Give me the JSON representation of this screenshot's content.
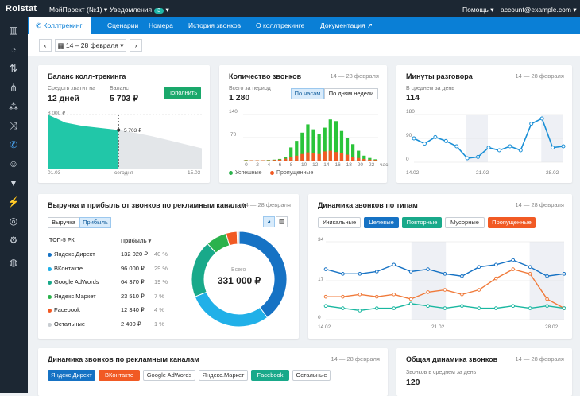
{
  "topbar": {
    "logo": "Roistat",
    "project": "МойПроект (№1)",
    "notifications": "Уведомления",
    "notifications_count": "3",
    "help": "Помощь",
    "account": "account@example.com"
  },
  "subnav": {
    "items": [
      "Коллтрекинг",
      "Сценарии",
      "Номера",
      "История звонков",
      "О коллтрекинге",
      "Документация"
    ]
  },
  "datebar": {
    "range": "14 – 28 февраля"
  },
  "balance": {
    "title": "Баланс колл-трекинга",
    "enough_label": "Средств хватит на",
    "enough_value": "12 дней",
    "balance_label": "Баланс",
    "balance_value": "5 703 ₽",
    "topup": "Пополнить",
    "chart_ylabel": "8 000 ₽",
    "marker": "5 703 ₽",
    "x_start": "01.03",
    "x_mid": "сегодня",
    "x_end": "15.03"
  },
  "calls_count": {
    "title": "Количество звонков",
    "date": "14 — 28 февраля",
    "total_label": "Всего за период",
    "total_value": "1 280",
    "tab_hours": "По часам",
    "tab_days": "По дням недели",
    "y_ticks": [
      "140",
      "70"
    ],
    "x_ticks": [
      "0",
      "2",
      "4",
      "6",
      "8",
      "10",
      "12",
      "14",
      "16",
      "18",
      "20",
      "22",
      "час."
    ],
    "legend_success": "Успешные",
    "legend_missed": "Пропущенные"
  },
  "minutes": {
    "title": "Минуты разговора",
    "date": "14 — 28 февраля",
    "avg_label": "В среднем за день",
    "avg_value": "114",
    "y_ticks": [
      "180",
      "90",
      "0"
    ],
    "x_ticks": [
      "14.02",
      "21.02",
      "28.02"
    ]
  },
  "revenue": {
    "title": "Выручка и прибыль от звонков по рекламным каналам",
    "date": "14 — 28 февраля",
    "tab_revenue": "Выручка",
    "tab_profit": "Прибыль",
    "col_top": "ТОП-5 РК",
    "col_profit": "Прибыль",
    "rows": [
      {
        "name": "Яндекс.Директ",
        "value": "132 020 ₽",
        "pct": "40 %",
        "color": "#1672c4"
      },
      {
        "name": "ВКонтакте",
        "value": "96 000 ₽",
        "pct": "29 %",
        "color": "#21b0e8"
      },
      {
        "name": "Google AdWords",
        "value": "64 370 ₽",
        "pct": "19 %",
        "color": "#19a98a"
      },
      {
        "name": "Яндекс.Маркет",
        "value": "23 510 ₽",
        "pct": "7 %",
        "color": "#2bb24c"
      },
      {
        "name": "Facebook",
        "value": "12 340 ₽",
        "pct": "4 %",
        "color": "#f15a24"
      },
      {
        "name": "Остальные",
        "value": "2 400 ₽",
        "pct": "1 %",
        "color": "#c8cdd2"
      }
    ],
    "donut_label": "Всего",
    "donut_value": "331 000 ₽"
  },
  "dynamics_types": {
    "title": "Динамика звонков по типам",
    "date": "14 — 28 февраля",
    "pills": [
      {
        "label": "Уникальные",
        "bg": "#ffffff",
        "fg": "#333333"
      },
      {
        "label": "Целевые",
        "bg": "#1672c4",
        "fg": "#ffffff"
      },
      {
        "label": "Повторные",
        "bg": "#19a98a",
        "fg": "#ffffff"
      },
      {
        "label": "Мусорные",
        "bg": "#ffffff",
        "fg": "#333333"
      },
      {
        "label": "Пропущенные",
        "bg": "#f15a24",
        "fg": "#ffffff"
      }
    ],
    "y_ticks": [
      "34",
      "17",
      "0"
    ],
    "x_ticks": [
      "14.02",
      "21.02",
      "28.02"
    ]
  },
  "dynamics_channels": {
    "title": "Динамика звонков по рекламным каналам",
    "date": "14 — 28 февраля",
    "pills": [
      {
        "label": "Яндекс.Директ",
        "bg": "#1672c4",
        "fg": "#ffffff"
      },
      {
        "label": "ВКонтакте",
        "bg": "#f15a24",
        "fg": "#ffffff"
      },
      {
        "label": "Google AdWords",
        "bg": "#ffffff",
        "fg": "#333333"
      },
      {
        "label": "Яндекс.Маркет",
        "bg": "#ffffff",
        "fg": "#333333"
      },
      {
        "label": "Facebook",
        "bg": "#19a98a",
        "fg": "#ffffff"
      },
      {
        "label": "Остальные",
        "bg": "#ffffff",
        "fg": "#333333"
      }
    ]
  },
  "overall": {
    "title": "Общая динамика звонков",
    "date": "14 — 28 февраля",
    "avg_label": "Звонков в среднем за день",
    "avg_value": "120"
  },
  "chart_data": [
    {
      "type": "area",
      "title": "Баланс колл-трекинга",
      "x": [
        "01.03",
        "сегодня",
        "15.03"
      ],
      "series": [
        {
          "values": [
            8000,
            6800,
            6300,
            6000,
            5703
          ],
          "segment": "past"
        },
        {
          "values": [
            5703,
            5300,
            4800,
            4200,
            3600,
            3000
          ],
          "segment": "forecast"
        }
      ],
      "ylim": [
        0,
        8000
      ]
    },
    {
      "type": "bar",
      "title": "Количество звонков",
      "categories": [
        "0",
        "1",
        "2",
        "3",
        "4",
        "5",
        "6",
        "7",
        "8",
        "9",
        "10",
        "11",
        "12",
        "13",
        "14",
        "15",
        "16",
        "17",
        "18",
        "19",
        "20",
        "21",
        "22",
        "23"
      ],
      "series": [
        {
          "name": "Успешные",
          "values": [
            2,
            1,
            1,
            1,
            2,
            3,
            5,
            12,
            40,
            60,
            85,
            110,
            95,
            80,
            100,
            125,
            120,
            90,
            70,
            50,
            30,
            15,
            8,
            4
          ]
        },
        {
          "name": "Пропущенные",
          "values": [
            1,
            1,
            1,
            1,
            1,
            2,
            3,
            6,
            12,
            15,
            20,
            25,
            22,
            20,
            28,
            30,
            26,
            22,
            18,
            12,
            8,
            5,
            3,
            2
          ]
        }
      ],
      "ylim": [
        0,
        140
      ]
    },
    {
      "type": "line",
      "title": "Минуты разговора",
      "x": [
        "14.02",
        "15.02",
        "16.02",
        "17.02",
        "18.02",
        "19.02",
        "20.02",
        "21.02",
        "22.02",
        "23.02",
        "24.02",
        "25.02",
        "26.02",
        "27.02",
        "28.02"
      ],
      "series": [
        {
          "values": [
            90,
            70,
            95,
            80,
            60,
            15,
            20,
            55,
            45,
            60,
            45,
            145,
            165,
            55,
            60
          ]
        }
      ],
      "ylim": [
        0,
        180
      ]
    },
    {
      "type": "pie",
      "title": "Выручка и прибыль от звонков по рекламным каналам",
      "categories": [
        "Яндекс.Директ",
        "ВКонтакте",
        "Google AdWords",
        "Яндекс.Маркет",
        "Facebook",
        "Остальные"
      ],
      "values": [
        132020,
        96000,
        64370,
        23510,
        12340,
        2400
      ]
    },
    {
      "type": "line",
      "title": "Динамика звонков по типам",
      "x": [
        "14.02",
        "15.02",
        "16.02",
        "17.02",
        "18.02",
        "19.02",
        "20.02",
        "21.02",
        "22.02",
        "23.02",
        "24.02",
        "25.02",
        "26.02",
        "27.02",
        "28.02"
      ],
      "series": [
        {
          "name": "Целевые",
          "values": [
            22,
            20,
            20,
            21,
            24,
            21,
            22,
            20,
            19,
            23,
            24,
            26,
            23,
            19,
            20
          ]
        },
        {
          "name": "Пропущенные",
          "values": [
            10,
            10,
            11,
            10,
            11,
            9,
            12,
            13,
            11,
            13,
            18,
            22,
            20,
            9,
            5
          ]
        },
        {
          "name": "Повторные",
          "values": [
            6,
            5,
            4,
            5,
            5,
            7,
            6,
            5,
            6,
            5,
            5,
            6,
            5,
            6,
            5
          ]
        }
      ],
      "ylim": [
        0,
        34
      ]
    }
  ]
}
